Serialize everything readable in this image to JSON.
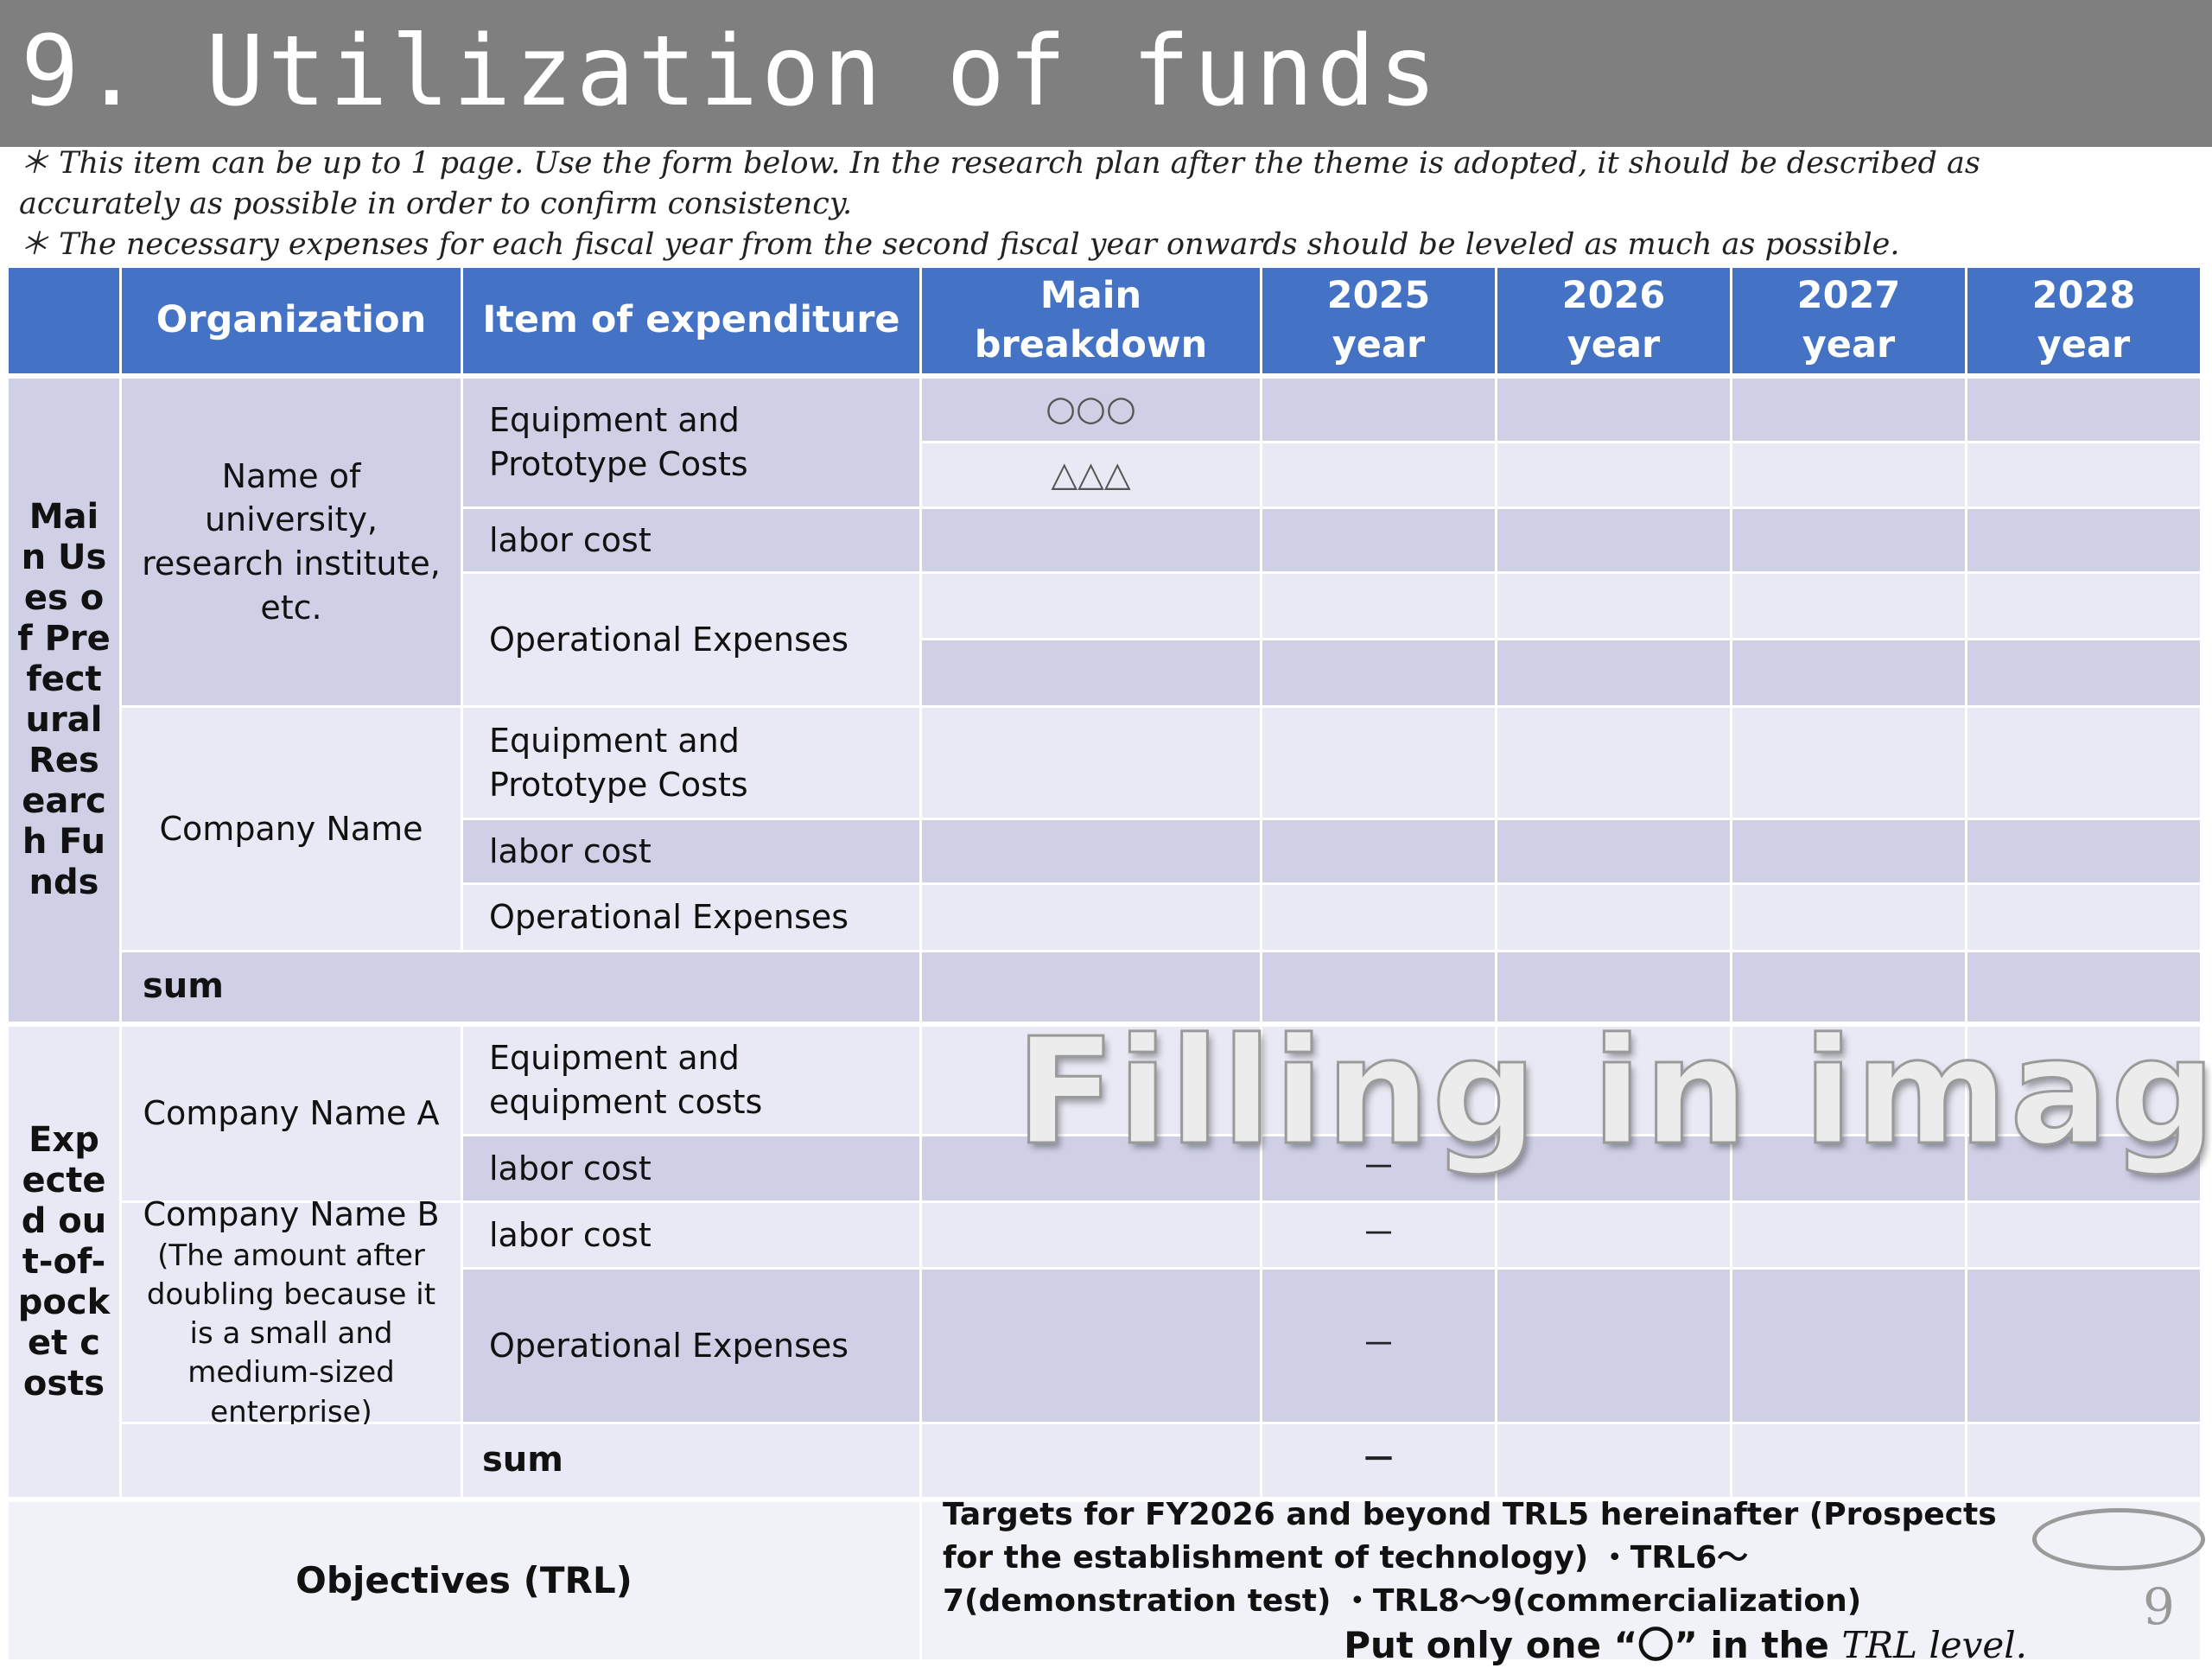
{
  "title": "9. Utilization of funds",
  "notes": [
    "＊ This item can be up to 1 page. Use the form below. In the research plan after the theme is adopted, it should be described as",
    "accurately as possible in order to confirm consistency.",
    "＊ The necessary expenses for each fiscal year from the second fiscal year onwards should be leveled as much as possible."
  ],
  "header": {
    "organization": "Organization",
    "item": "Item of expenditure",
    "breakdown": "Main breakdown",
    "years": [
      "2025 year",
      "2026 year",
      "2027 year",
      "2028 year"
    ]
  },
  "section1": {
    "label": "Main Uses of Prefectural Research Funds",
    "org_univ": "Name of university, research institute, etc.",
    "org_company": "Company Name",
    "item_equip": "Equipment and Prototype Costs",
    "item_labor": "labor cost",
    "item_ops": "Operational Expenses",
    "mark_circles": "○○○",
    "mark_triangles": "△△△",
    "sum": "sum"
  },
  "section2": {
    "label": "Expected out-of-pocket costs",
    "org_a": "Company Name A",
    "org_b": "Company Name B",
    "org_b_note": "(The amount after doubling because it is a small and medium-sized enterprise)",
    "item_equip": "Equipment and equipment costs",
    "item_labor": "labor cost",
    "item_ops": "Operational Expenses",
    "dash": "－",
    "sum": "sum"
  },
  "objectives": {
    "label": "Objectives (TRL)",
    "text": "Targets for FY2026 and beyond TRL5 hereinafter (Prospects for the establishment of technology) ・TRL6～7(demonstration test) ・TRL8～9(commercialization)",
    "instruction": "Put only one “〇” in the",
    "instruction_italic": "TRL level."
  },
  "watermark": "Filling in image",
  "page_number": "9"
}
